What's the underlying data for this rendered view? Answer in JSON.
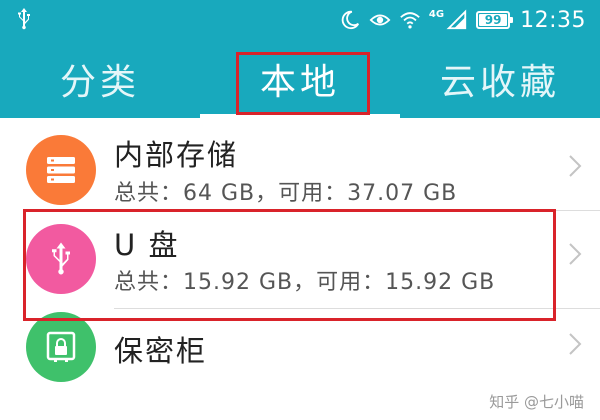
{
  "status_bar": {
    "network": "4G",
    "battery": "99",
    "time": "12:35",
    "icons": [
      "usb-icon",
      "moon-icon",
      "eye-icon",
      "wifi-icon",
      "signal-icon",
      "battery-icon"
    ]
  },
  "tabs": [
    {
      "label": "分类"
    },
    {
      "label": "本地"
    },
    {
      "label": "云收藏"
    }
  ],
  "storage": [
    {
      "title": "内部存储",
      "subtitle": "总共：64 GB，可用：37.07 GB",
      "icon": "storage-icon",
      "color": "#fa7a38"
    },
    {
      "title": "U 盘",
      "subtitle": "总共：15.92 GB，可用：15.92 GB",
      "icon": "usb-icon",
      "color": "#f25aa0"
    },
    {
      "title": "保密柜",
      "subtitle": "",
      "icon": "safe-icon",
      "color": "#3fc16b"
    }
  ],
  "watermark": "知乎 @七小喵",
  "colors": {
    "header": "#18a9bd",
    "highlight": "#d9232a"
  }
}
